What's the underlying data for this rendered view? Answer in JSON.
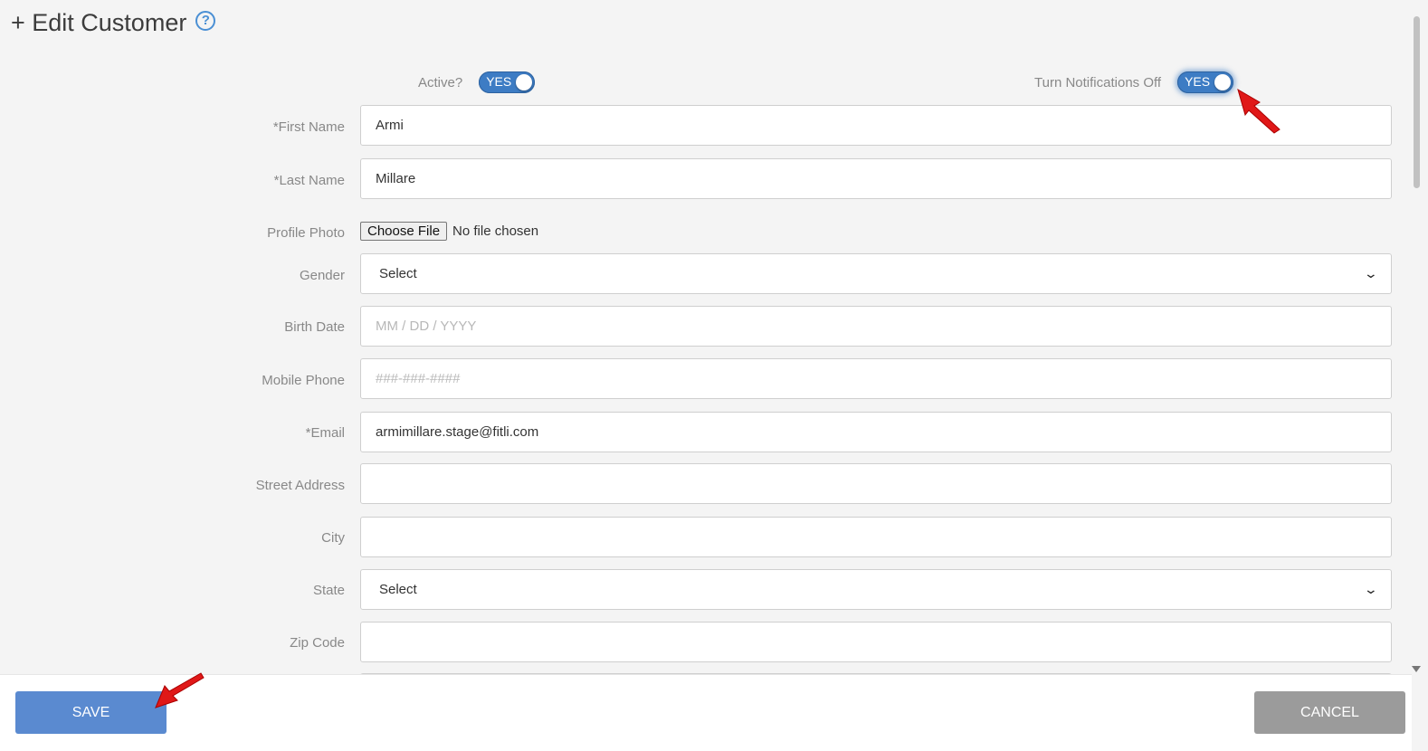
{
  "header": {
    "title": "+ Edit Customer",
    "help": "?"
  },
  "toggles": {
    "active": {
      "label": "Active?",
      "value": "YES"
    },
    "notifications": {
      "label": "Turn Notifications Off",
      "value": "YES"
    }
  },
  "form": {
    "first_name": {
      "label": "*First Name",
      "value": "Armi"
    },
    "last_name": {
      "label": "*Last Name",
      "value": "Millare"
    },
    "profile_photo": {
      "label": "Profile Photo",
      "button": "Choose File",
      "status": "No file chosen"
    },
    "gender": {
      "label": "Gender",
      "value": "Select"
    },
    "birth_date": {
      "label": "Birth Date",
      "placeholder": "MM / DD / YYYY"
    },
    "mobile_phone": {
      "label": "Mobile Phone",
      "placeholder": "###-###-####"
    },
    "email": {
      "label": "*Email",
      "value": "armimillare.stage@fitli.com"
    },
    "street_address": {
      "label": "Street Address",
      "value": ""
    },
    "city": {
      "label": "City",
      "value": ""
    },
    "state": {
      "label": "State",
      "value": "Select"
    },
    "zip_code": {
      "label": "Zip Code",
      "value": ""
    }
  },
  "footer": {
    "save": "SAVE",
    "cancel": "CANCEL"
  },
  "colors": {
    "accent": "#3d7cc4",
    "save": "#5a8ad0",
    "cancel": "#9b9b9b",
    "annotation_arrow": "#e01818"
  }
}
